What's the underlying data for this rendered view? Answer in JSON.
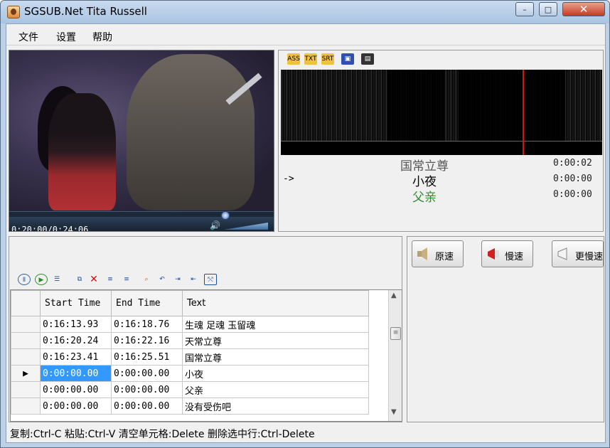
{
  "window": {
    "title": "SGSUB.Net Tita Russell",
    "minimize": "–",
    "maximize": "□",
    "close": "✕"
  },
  "menu": [
    "文件",
    "设置",
    "帮助"
  ],
  "player": {
    "time": "0:20:00/0:24:06",
    "volume_fraction": 0.85
  },
  "wave_toolbar": [
    "ASS",
    "TXT",
    "SRT",
    "save",
    "video"
  ],
  "subtitle_preview": [
    {
      "text": "国常立尊",
      "time": "0:00:02",
      "color": "#555555",
      "arrow": ""
    },
    {
      "text": "小夜",
      "time": "0:00:00",
      "color": "#000000",
      "arrow": "->"
    },
    {
      "text": "父亲",
      "time": "0:00:00",
      "color": "#2e8b2e",
      "arrow": ""
    }
  ],
  "grid": {
    "headers": [
      "",
      "Start Time",
      "End Time",
      "Text"
    ],
    "rows": [
      {
        "marker": "",
        "start": "0:16:13.93",
        "end": "0:16:18.76",
        "text": "生魂 足魂 玉留魂",
        "selected": false
      },
      {
        "marker": "",
        "start": "0:16:20.24",
        "end": "0:16:22.16",
        "text": "天常立尊",
        "selected": false
      },
      {
        "marker": "",
        "start": "0:16:23.41",
        "end": "0:16:25.51",
        "text": "国常立尊",
        "selected": false
      },
      {
        "marker": "▶",
        "start": "0:00:00.00",
        "end": "0:00:00.00",
        "text": "小夜",
        "selected": true
      },
      {
        "marker": "",
        "start": "0:00:00.00",
        "end": "0:00:00.00",
        "text": "父亲",
        "selected": false
      },
      {
        "marker": "",
        "start": "0:00:00.00",
        "end": "0:00:00.00",
        "text": "没有受伤吧",
        "selected": false
      }
    ]
  },
  "speed": {
    "normal": "原速",
    "slow": "慢速",
    "slower": "更慢速"
  },
  "status": "复制:Ctrl-C  粘贴:Ctrl-V  清空单元格:Delete  删除选中行:Ctrl-Delete"
}
